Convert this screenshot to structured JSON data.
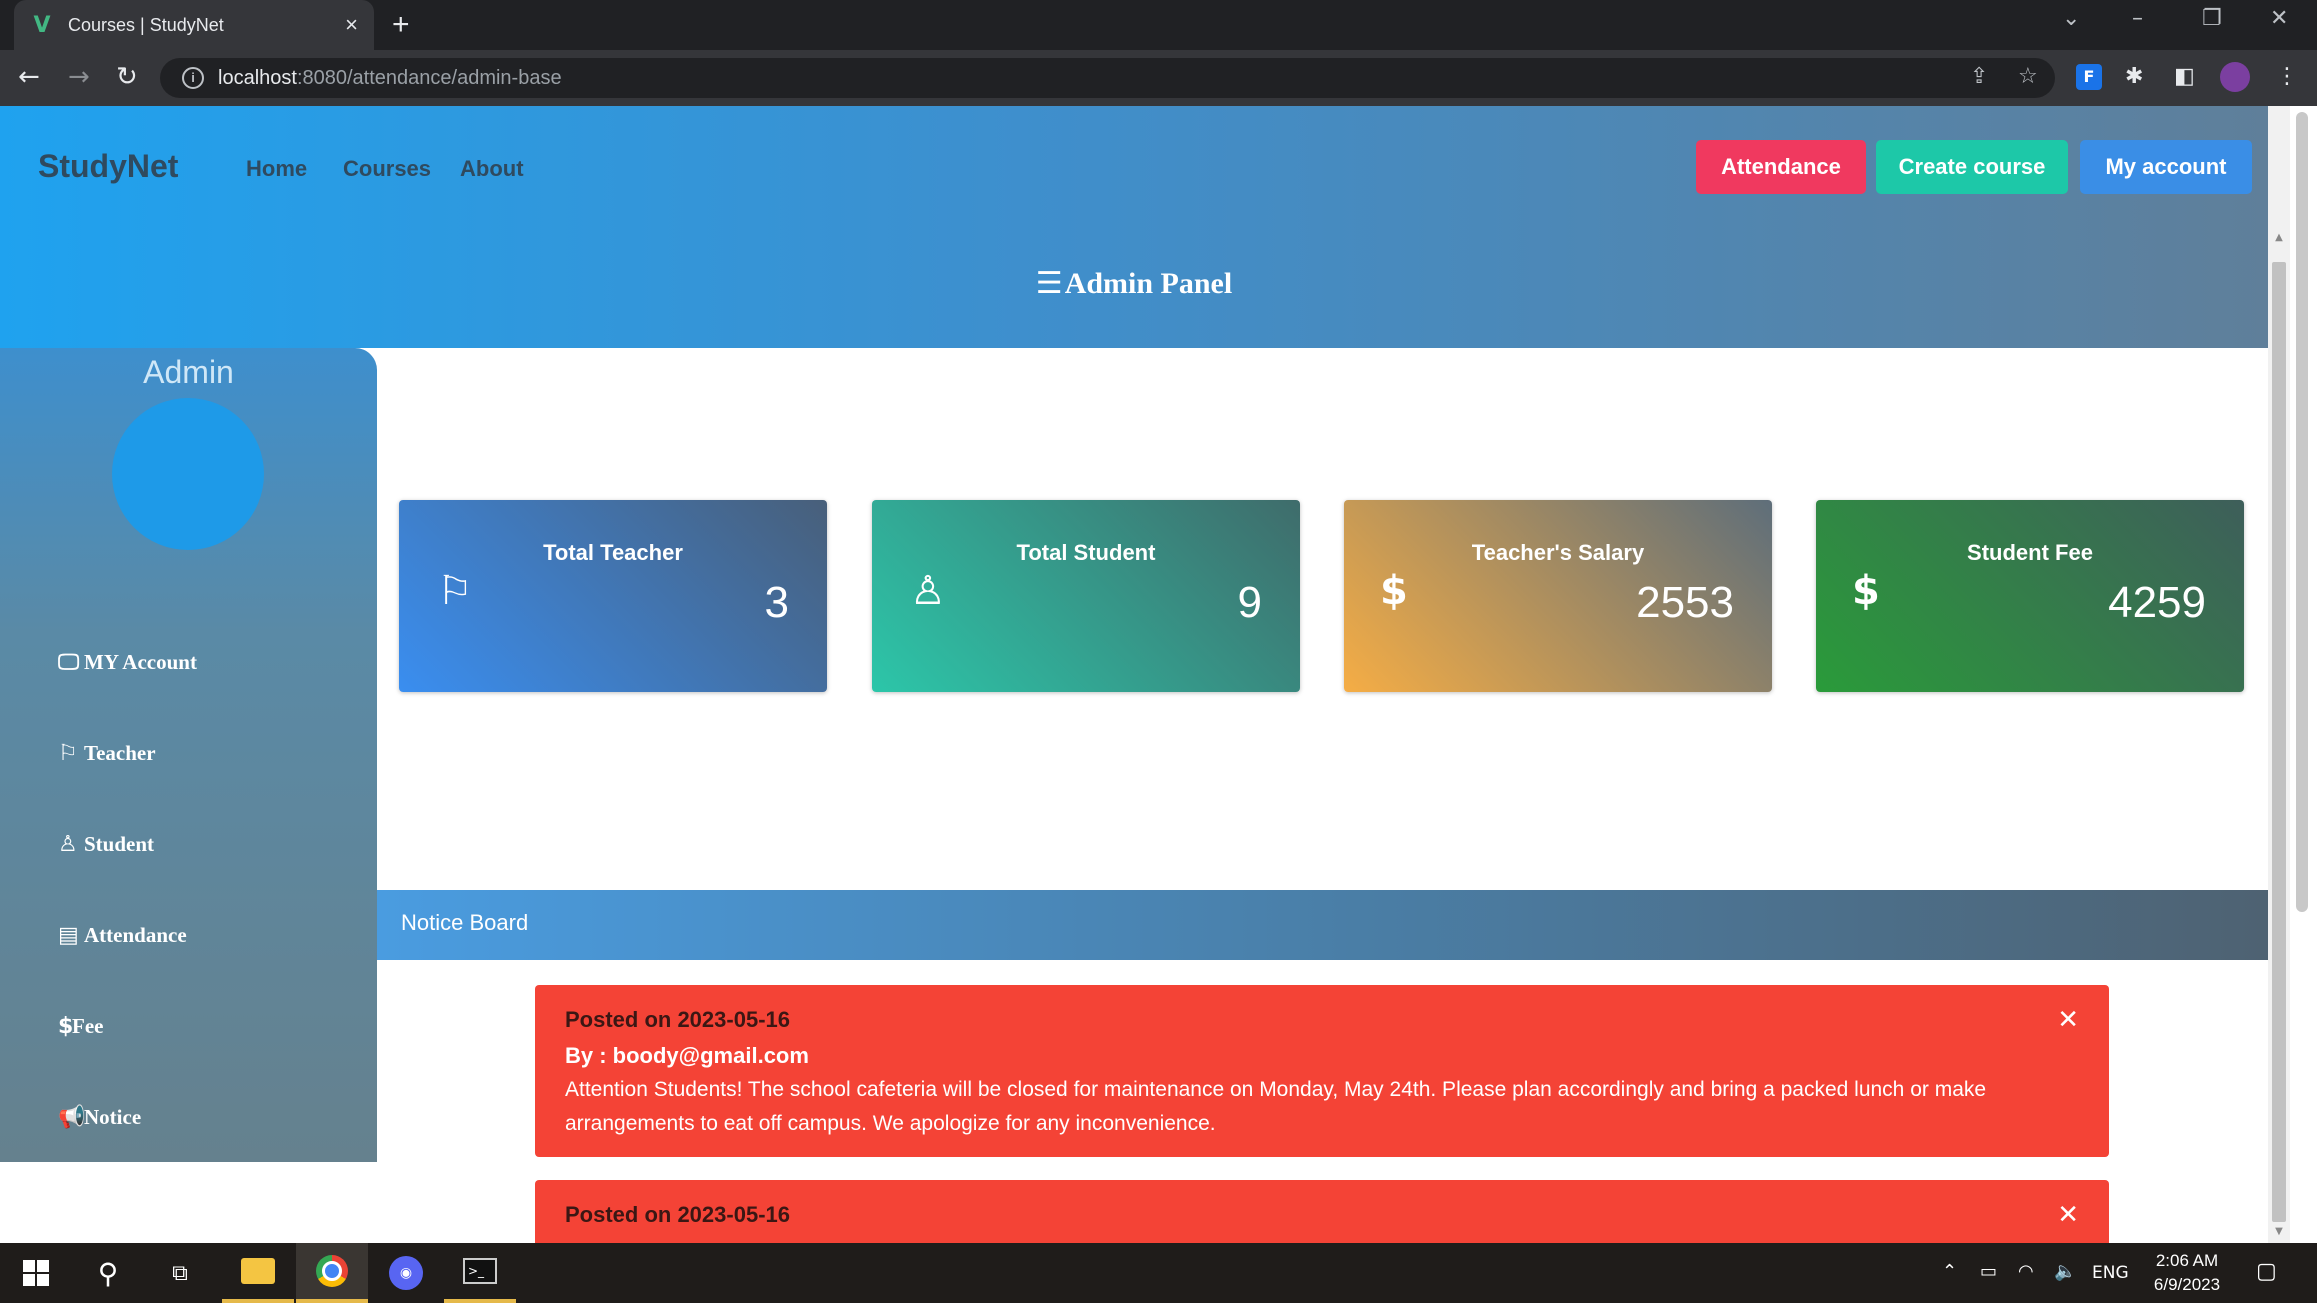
{
  "browser": {
    "tab_title": "Courses | StudyNet",
    "url_host": "localhost",
    "url_path": ":8080/attendance/admin-base"
  },
  "header": {
    "brand": "StudyNet",
    "nav": [
      "Home",
      "Courses",
      "About"
    ],
    "buttons": [
      {
        "label": "Attendance",
        "color": "#f0395f"
      },
      {
        "label": "Create course",
        "color": "#1dc8a8"
      },
      {
        "label": "My account",
        "color": "#3a8ee6"
      }
    ],
    "panel_title": "Admin Panel"
  },
  "sidebar": {
    "heading": "Admin",
    "items": [
      {
        "label": "MY Account",
        "icon": "monitor-icon"
      },
      {
        "label": "Teacher",
        "icon": "teacher-icon"
      },
      {
        "label": "Student",
        "icon": "student-icon"
      },
      {
        "label": "Attendance",
        "icon": "id-card-icon"
      },
      {
        "label": "Fee",
        "icon": "dollar-icon"
      },
      {
        "label": "Notice",
        "icon": "megaphone-icon"
      }
    ]
  },
  "cards": [
    {
      "title": "Total Teacher",
      "value": "3",
      "icon": "teacher-icon",
      "colors": [
        "#3a8ef0",
        "#485f7a"
      ]
    },
    {
      "title": "Total Student",
      "value": "9",
      "icon": "student-icon",
      "colors": [
        "#2cc6a9",
        "#3f6c6b"
      ]
    },
    {
      "title": "Teacher's Salary",
      "value": "2553",
      "icon": "dollar-icon",
      "colors": [
        "#f5ad45",
        "#5e6e7a"
      ]
    },
    {
      "title": "Student Fee",
      "value": "4259",
      "icon": "dollar-icon",
      "colors": [
        "#2a9b3a",
        "#3e5e5a"
      ]
    }
  ],
  "notice_board": {
    "title": "Notice Board",
    "notices": [
      {
        "date": "Posted on 2023-05-16",
        "by": "By : boody@gmail.com",
        "text": "Attention Students! The school cafeteria will be closed for maintenance on Monday, May 24th. Please plan accordingly and bring a packed lunch or make arrangements to eat off campus. We apologize for any inconvenience."
      },
      {
        "date": "Posted on 2023-05-16",
        "by": "",
        "text": ""
      }
    ]
  },
  "taskbar": {
    "language": "ENG",
    "time": "2:06 AM",
    "date": "6/9/2023"
  }
}
